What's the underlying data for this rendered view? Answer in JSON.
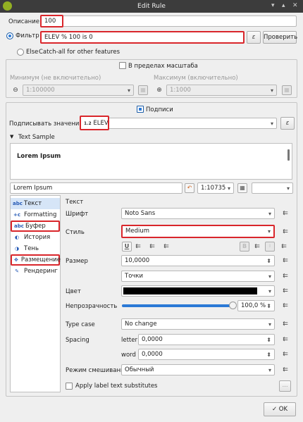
{
  "window": {
    "title": "Edit Rule",
    "min_icon": "chevron-down-icon",
    "max_icon": "chevron-up-icon",
    "close_icon": "close-icon"
  },
  "rule": {
    "description_label": "Описание",
    "description_value": "100",
    "filter_label": "Фильтр",
    "filter_value": "ELEV % 100 is 0",
    "epsilon_symbol": "ε",
    "check_button": "Проверить",
    "else_label": "Else",
    "else_description": "Catch-all for other features"
  },
  "scale": {
    "title": "В пределах масштаба",
    "min_label": "Минимум (не включительно)",
    "max_label": "Максимум (включительно)",
    "min_value": "1:100000",
    "max_value": "1:1000"
  },
  "labels": {
    "title": "Подписи",
    "label_with": "Подписывать значениями",
    "field_type_badge": "1.2",
    "field_value": "ELEV",
    "text_sample_title": "Text Sample",
    "preview_text": "Lorem Ipsum",
    "sample_input": "Lorem Ipsum",
    "preview_scale": "1:10735"
  },
  "sidebar": {
    "items": [
      {
        "label": "Текст",
        "icon": "abc-icon",
        "selected": true
      },
      {
        "label": "Formatting",
        "icon": "formatting-icon"
      },
      {
        "label": "Буфер",
        "icon": "abc-buffer-icon"
      },
      {
        "label": "История",
        "icon": "background-icon"
      },
      {
        "label": "Тень",
        "icon": "shadow-icon"
      },
      {
        "label": "Размещение",
        "icon": "placement-icon"
      },
      {
        "label": "Рендеринг",
        "icon": "rendering-icon"
      }
    ]
  },
  "text_panel": {
    "heading": "Текст",
    "font_label": "Шрифт",
    "font_value": "Noto Sans",
    "style_label": "Стиль",
    "style_value": "Medium",
    "underline": "U",
    "bold": "B",
    "size_label": "Размер",
    "size_value": "10,0000",
    "size_unit": "Точки",
    "color_label": "Цвет",
    "color_value": "#000000",
    "opacity_label": "Непрозрачность",
    "opacity_value": "100,0 %",
    "opacity_fraction": 1.0,
    "case_label": "Type case",
    "case_value": "No change",
    "spacing_label": "Spacing",
    "letter_label": "letter",
    "letter_value": "0,0000",
    "word_label": "word",
    "word_value": "0,0000",
    "blend_label": "Режим смешивания",
    "blend_value": "Обычный",
    "substitutes_label": "Apply label text substitutes",
    "more_button": "..."
  },
  "footer": {
    "ok_label": "OK"
  },
  "accent": "#2b79d6",
  "highlight": "#d9262b"
}
